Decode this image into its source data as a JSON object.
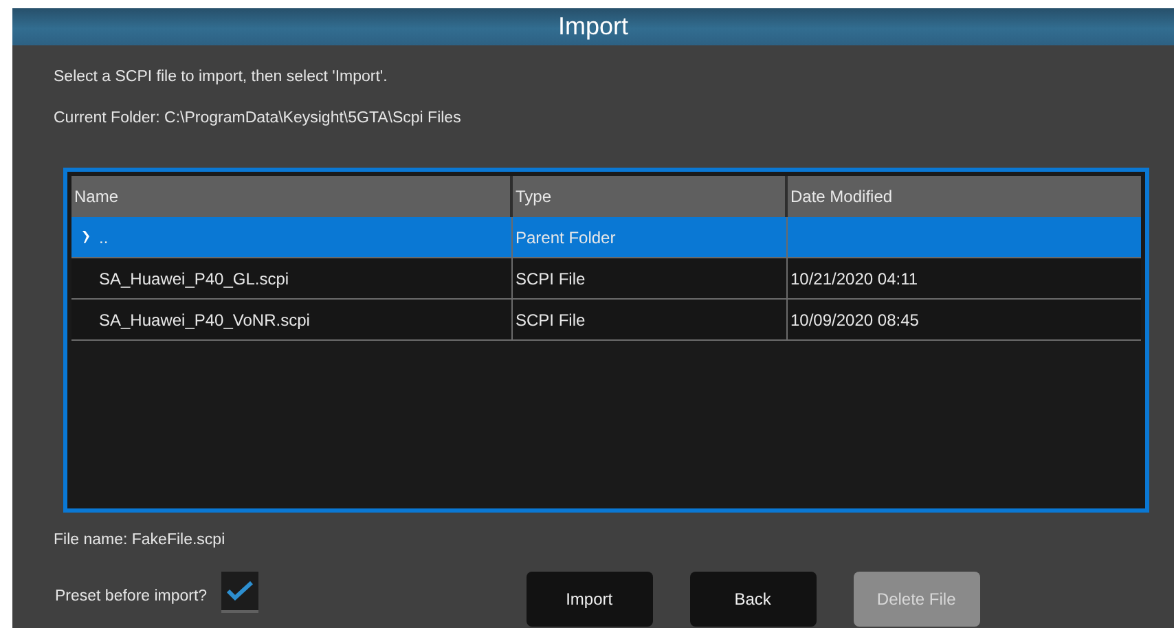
{
  "window": {
    "title": "Import"
  },
  "instructions": "Select a SCPI file to import, then select 'Import'.",
  "current_folder": "Current Folder: C:\\ProgramData\\Keysight\\5GTA\\Scpi Files",
  "table": {
    "columns": [
      "Name",
      "Type",
      "Date Modified"
    ],
    "rows": [
      {
        "kind": "parent",
        "name": "..",
        "type": "Parent Folder",
        "date": "",
        "selected": true
      },
      {
        "kind": "file",
        "name": "SA_Huawei_P40_GL.scpi",
        "type": "SCPI File",
        "date": "10/21/2020 04:11",
        "selected": false
      },
      {
        "kind": "file",
        "name": "SA_Huawei_P40_VoNR.scpi",
        "type": "SCPI File",
        "date": "10/09/2020 08:45",
        "selected": false
      }
    ]
  },
  "file_name": "File name: FakeFile.scpi",
  "preset": {
    "label": "Preset before import?",
    "checked": true
  },
  "buttons": [
    {
      "label": "Import",
      "disabled": false
    },
    {
      "label": "Back",
      "disabled": false
    },
    {
      "label": "Delete File",
      "disabled": true
    }
  ]
}
